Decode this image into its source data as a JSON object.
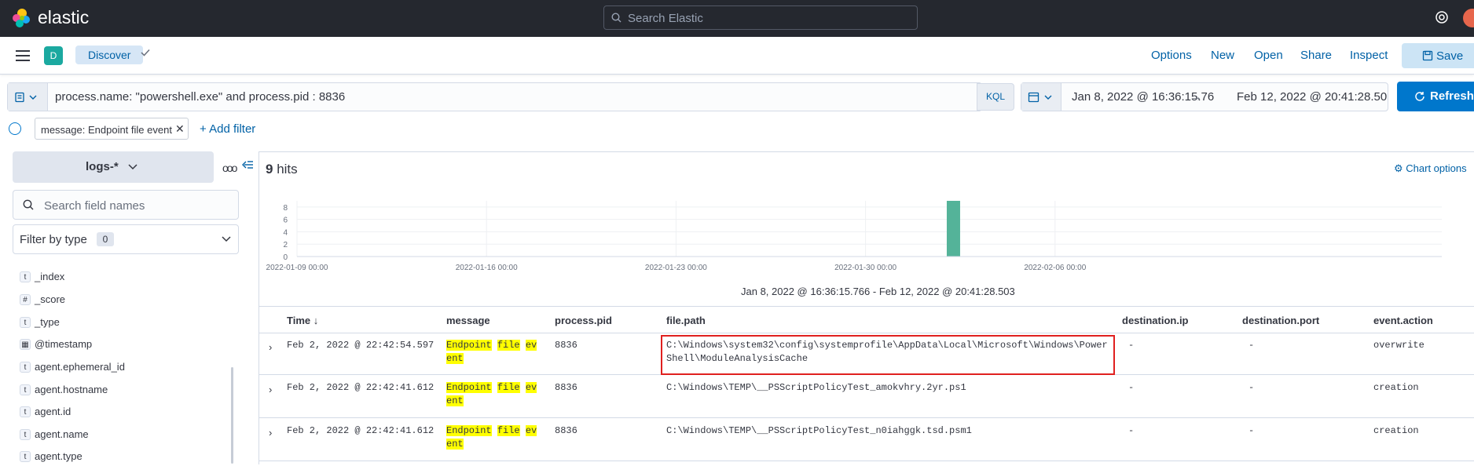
{
  "topbar": {
    "brand": "elastic",
    "search_placeholder": "Search Elastic"
  },
  "appheader": {
    "space_initial": "D",
    "breadcrumb": "Discover",
    "links": [
      "Options",
      "New",
      "Open",
      "Share",
      "Inspect"
    ],
    "save_label": "Save"
  },
  "query": {
    "text": "process.name: \"powershell.exe\" and process.pid : 8836",
    "language": "KQL"
  },
  "time": {
    "start": "Jan 8, 2022 @ 16:36:15.76",
    "end": "Feb 12, 2022 @ 20:41:28.50",
    "refresh_label": "Refresh"
  },
  "filters": {
    "pill": "message: Endpoint file event",
    "add_label": "+ Add filter"
  },
  "sidebar": {
    "index_pattern": "logs-*",
    "search_placeholder": "Search field names",
    "filter_by_type": "Filter by type",
    "filter_count": "0",
    "fields": [
      {
        "type": "t",
        "name": "_index"
      },
      {
        "type": "#",
        "name": "_score"
      },
      {
        "type": "t",
        "name": "_type"
      },
      {
        "type": "date",
        "name": "@timestamp"
      },
      {
        "type": "t",
        "name": "agent.ephemeral_id"
      },
      {
        "type": "t",
        "name": "agent.hostname"
      },
      {
        "type": "t",
        "name": "agent.id"
      },
      {
        "type": "t",
        "name": "agent.name"
      },
      {
        "type": "t",
        "name": "agent.type"
      }
    ]
  },
  "results": {
    "hits_count": "9",
    "hits_label": "hits",
    "chart_options_label": "Chart options",
    "range_label": "Jan 8, 2022 @ 16:36:15.766 - Feb 12, 2022 @ 20:41:28.503"
  },
  "chart_data": {
    "type": "bar",
    "x_tick_labels": [
      "2022-01-09 00:00",
      "2022-01-16 00:00",
      "2022-01-23 00:00",
      "2022-01-30 00:00",
      "2022-02-06 00:00"
    ],
    "y_ticks": [
      0,
      2,
      4,
      6,
      8
    ],
    "ylim": [
      0,
      9
    ],
    "bars": [
      {
        "x": "2022-02-02",
        "value": 9
      }
    ],
    "color": "#54b399"
  },
  "table": {
    "columns": [
      "Time ↓",
      "message",
      "process.pid",
      "file.path",
      "destination.ip",
      "destination.port",
      "event.action"
    ],
    "rows": [
      {
        "time": "Feb 2, 2022 @ 22:42:54.597",
        "msg": [
          "Endpoint",
          "file",
          "ev",
          "ent"
        ],
        "pid": "8836",
        "path": "C:\\Windows\\system32\\config\\systemprofile\\AppData\\Local\\Microsoft\\Windows\\PowerShell\\ModuleAnalysisCache",
        "dest_ip": "-",
        "dest_port": "-",
        "action": "overwrite"
      },
      {
        "time": "Feb 2, 2022 @ 22:42:41.612",
        "msg": [
          "Endpoint",
          "file",
          "ev",
          "ent"
        ],
        "pid": "8836",
        "path": "C:\\Windows\\TEMP\\__PSScriptPolicyTest_amokvhry.2yr.ps1",
        "dest_ip": "-",
        "dest_port": "-",
        "action": "creation"
      },
      {
        "time": "Feb 2, 2022 @ 22:42:41.612",
        "msg": [
          "Endpoint",
          "file",
          "ev",
          "ent"
        ],
        "pid": "8836",
        "path": "C:\\Windows\\TEMP\\__PSScriptPolicyTest_n0iahggk.tsd.psm1",
        "dest_ip": "-",
        "dest_port": "-",
        "action": "creation"
      }
    ]
  }
}
